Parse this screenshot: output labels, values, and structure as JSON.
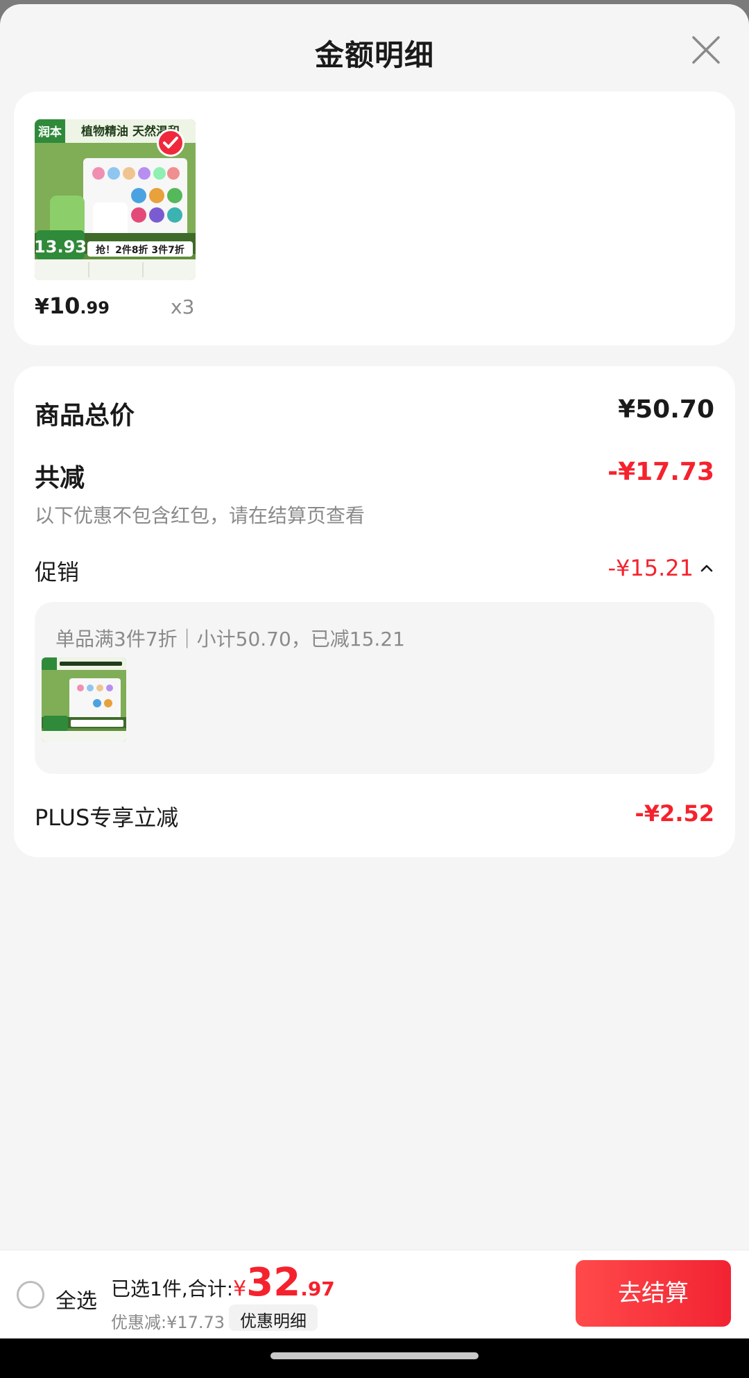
{
  "colors": {
    "accent_red": "#f5222d",
    "sheet_bg": "#f5f5f5",
    "card_bg": "#ffffff",
    "muted_text": "#8a8a8a"
  },
  "header": {
    "title": "金额明细",
    "close_icon": "close-icon"
  },
  "product": {
    "image_text": {
      "brand": "润本",
      "headline": "植物精油 天然温和",
      "price_tag": "13.93",
      "promo": "抢！2件8折 3件7折"
    },
    "price_currency": "¥",
    "price_int": "10",
    "price_dec": ".99",
    "quantity": "x3",
    "selected": true
  },
  "summary": {
    "total_label": "商品总价",
    "total_value": "¥50.70",
    "reduce_label": "共减",
    "reduce_value": "-¥17.73",
    "note": "以下优惠不包含红包，请在结算页查看",
    "promo_label": "促销",
    "promo_value": "-¥15.21",
    "promo_expanded": true,
    "promo_desc": "单品满3件7折｜小计50.70，已减15.21",
    "plus_label": "PLUS专享立减",
    "plus_value": "-¥2.52"
  },
  "footer": {
    "select_all_label": "全选",
    "select_all_checked": false,
    "selected_prefix": "已选1件,合计:",
    "total_currency": "¥",
    "total_int": "32",
    "total_dec": ".97",
    "discount_text": "优惠减:¥17.73",
    "detail_button": "优惠明细",
    "checkout_button": "去结算"
  }
}
